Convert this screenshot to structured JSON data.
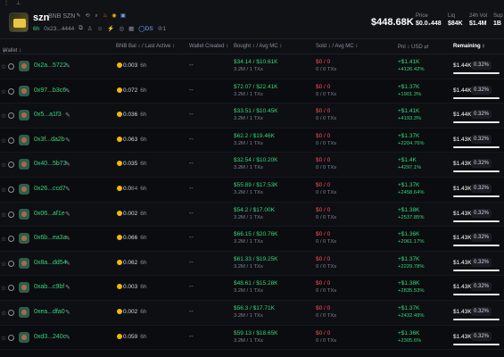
{
  "header": {
    "token_symbol": "szn",
    "token_name": "BNB SZN",
    "age": "6h",
    "contract": "0x23...4444",
    "sub_count": "1",
    "ds_label": "DS",
    "market_cap": "$448.68K",
    "stats": [
      {
        "label": "Price",
        "value": "$0.0₄448"
      },
      {
        "label": "Liq",
        "value": "$84K"
      },
      {
        "label": "24h Vol",
        "value": "$1.4M"
      },
      {
        "label": "Sup",
        "value": "1B"
      }
    ]
  },
  "table": {
    "columns": {
      "wallet": "Wallet ↕",
      "bnb_bal": "BNB Bal ↕ / Last Active ↕",
      "wallet_created": "Wallet Created ↕",
      "bought": "Bought ↕ / Avg MC ↕",
      "sold": "Sold ↕ / Avg MC ↕",
      "pnl": "Pnl ↕  USD ⇄",
      "remaining": "Remaining ↕"
    },
    "rows": [
      {
        "wallet": "0x2a...5722",
        "bal": "0.003",
        "bal_small": "",
        "active": "6h",
        "created": "--",
        "bought": "$34.14 / $10.61K",
        "bought_sub": "3.2M / 1 TXs",
        "sold": "$0 / 0",
        "sold_sub": "0 / 0 TXs",
        "pnl": "+$1.41K",
        "pnl_pct": "+4126.42%",
        "remaining": "$1.44K",
        "remaining_pct": "0.32%",
        "remaining_fill": 1.0
      },
      {
        "wallet": "0x97...b3c6",
        "bal": "0.072",
        "bal_small": "",
        "active": "6h",
        "created": "--",
        "bought": "$72.07 / $22.41K",
        "bought_sub": "3.2M / 1 TXs",
        "sold": "$0 / 0",
        "sold_sub": "0 / 0 TXs",
        "pnl": "+$1.37K",
        "pnl_pct": "+1901.3%",
        "remaining": "$1.44K",
        "remaining_pct": "0.32%",
        "remaining_fill": 1.0
      },
      {
        "wallet": "0x5...a1f3",
        "bal": "0.036",
        "bal_small": "",
        "active": "6h",
        "created": "--",
        "bought": "$33.51 / $10.45K",
        "bought_sub": "3.2M / 1 TXs",
        "sold": "$0 / 0",
        "sold_sub": "0 / 0 TXs",
        "pnl": "+$1.41K",
        "pnl_pct": "+4193.3%",
        "remaining": "$1.44K",
        "remaining_pct": "0.32%",
        "remaining_fill": 1.0
      },
      {
        "wallet": "0x3f...da2b",
        "bal": "0.063",
        "bal_small": "",
        "active": "6h",
        "created": "--",
        "bought": "$62.2 / $19.46K",
        "bought_sub": "3.2M / 1 TXs",
        "sold": "$0 / 0",
        "sold_sub": "0 / 0 TXs",
        "pnl": "+$1.37K",
        "pnl_pct": "+2204.76%",
        "remaining": "$1.43K",
        "remaining_pct": "0.32%",
        "remaining_fill": 1.0
      },
      {
        "wallet": "0x40...5b73",
        "bal": "0.035",
        "bal_small": "",
        "active": "6h",
        "created": "--",
        "bought": "$32.54 / $10.20K",
        "bought_sub": "3.2M / 1 TXs",
        "sold": "$0 / 0",
        "sold_sub": "0 / 0 TXs",
        "pnl": "+$1.4K",
        "pnl_pct": "+4297.1%",
        "remaining": "$1.43K",
        "remaining_pct": "0.32%",
        "remaining_fill": 1.0
      },
      {
        "wallet": "0x26...ccd7",
        "bal": "0.0",
        "bal_small": "84",
        "active": "6h",
        "created": "--",
        "bought": "$55.89 / $17.53K",
        "bought_sub": "3.2M / 1 TXs",
        "sold": "$0 / 0",
        "sold_sub": "0 / 0 TXs",
        "pnl": "+$1.37K",
        "pnl_pct": "+2458.64%",
        "remaining": "$1.43K",
        "remaining_pct": "0.32%",
        "remaining_fill": 1.0
      },
      {
        "wallet": "0x06...af1e",
        "bal": "0.002",
        "bal_small": "",
        "active": "6h",
        "created": "--",
        "bought": "$54.2 / $17.00K",
        "bought_sub": "3.2M / 1 TXs",
        "sold": "$0 / 0",
        "sold_sub": "0 / 0 TXs",
        "pnl": "+$1.38K",
        "pnl_pct": "+2537.85%",
        "remaining": "$1.43K",
        "remaining_pct": "0.32%",
        "remaining_fill": 1.0
      },
      {
        "wallet": "0x6b...ea3a",
        "bal": "0.066",
        "bal_small": "",
        "active": "6h",
        "created": "--",
        "bought": "$66.15 / $20.76K",
        "bought_sub": "3.2M / 1 TXs",
        "sold": "$0 / 0",
        "sold_sub": "0 / 0 TXs",
        "pnl": "+$1.36K",
        "pnl_pct": "+2061.17%",
        "remaining": "$1.43K",
        "remaining_pct": "0.32%",
        "remaining_fill": 1.0
      },
      {
        "wallet": "0x8a...dd54",
        "bal": "0.062",
        "bal_small": "",
        "active": "6h",
        "created": "--",
        "bought": "$61.33 / $19.25K",
        "bought_sub": "3.2M / 1 TXs",
        "sold": "$0 / 0",
        "sold_sub": "0 / 0 TXs",
        "pnl": "+$1.37K",
        "pnl_pct": "+2229.78%",
        "remaining": "$1.43K",
        "remaining_pct": "0.32%",
        "remaining_fill": 1.0
      },
      {
        "wallet": "0xab...c9bf",
        "bal": "0.003",
        "bal_small": "",
        "active": "6h",
        "created": "--",
        "bought": "$48.61 / $15.28K",
        "bought_sub": "3.2M / 1 TXs",
        "sold": "$0 / 0",
        "sold_sub": "0 / 0 TXs",
        "pnl": "+$1.38K",
        "pnl_pct": "+2835.53%",
        "remaining": "$1.43K",
        "remaining_pct": "0.32%",
        "remaining_fill": 1.0
      },
      {
        "wallet": "0xea...dfa0",
        "bal": "0.002",
        "bal_small": "",
        "active": "6h",
        "created": "--",
        "bought": "$56.3 / $17.71K",
        "bought_sub": "3.2M / 1 TXs",
        "sold": "$0 / 0",
        "sold_sub": "0 / 0 TXs",
        "pnl": "+$1.37K",
        "pnl_pct": "+2432.49%",
        "remaining": "$1.43K",
        "remaining_pct": "0.32%",
        "remaining_fill": 1.0
      },
      {
        "wallet": "0xd3...240c",
        "bal": "0.059",
        "bal_small": "",
        "active": "6h",
        "created": "--",
        "bought": "$59.13 / $18.65K",
        "bought_sub": "3.2M / 1 TXs",
        "sold": "$0 / 0",
        "sold_sub": "0 / 0 TXs",
        "pnl": "+$1.36K",
        "pnl_pct": "+2305.6%",
        "remaining": "$1.43K",
        "remaining_pct": "0.32%",
        "remaining_fill": 1.0
      }
    ]
  },
  "colors": {
    "positive": "#37d67a",
    "negative": "#ff4d5e",
    "bnb": "#f0b90b",
    "background": "#0b0c0f"
  },
  "icons": [
    "star-icon",
    "ring-icon",
    "pencil-icon",
    "bnb-icon",
    "copy-icon",
    "share-icon",
    "search-icon",
    "flame-icon",
    "globe-icon",
    "telegram-icon"
  ]
}
